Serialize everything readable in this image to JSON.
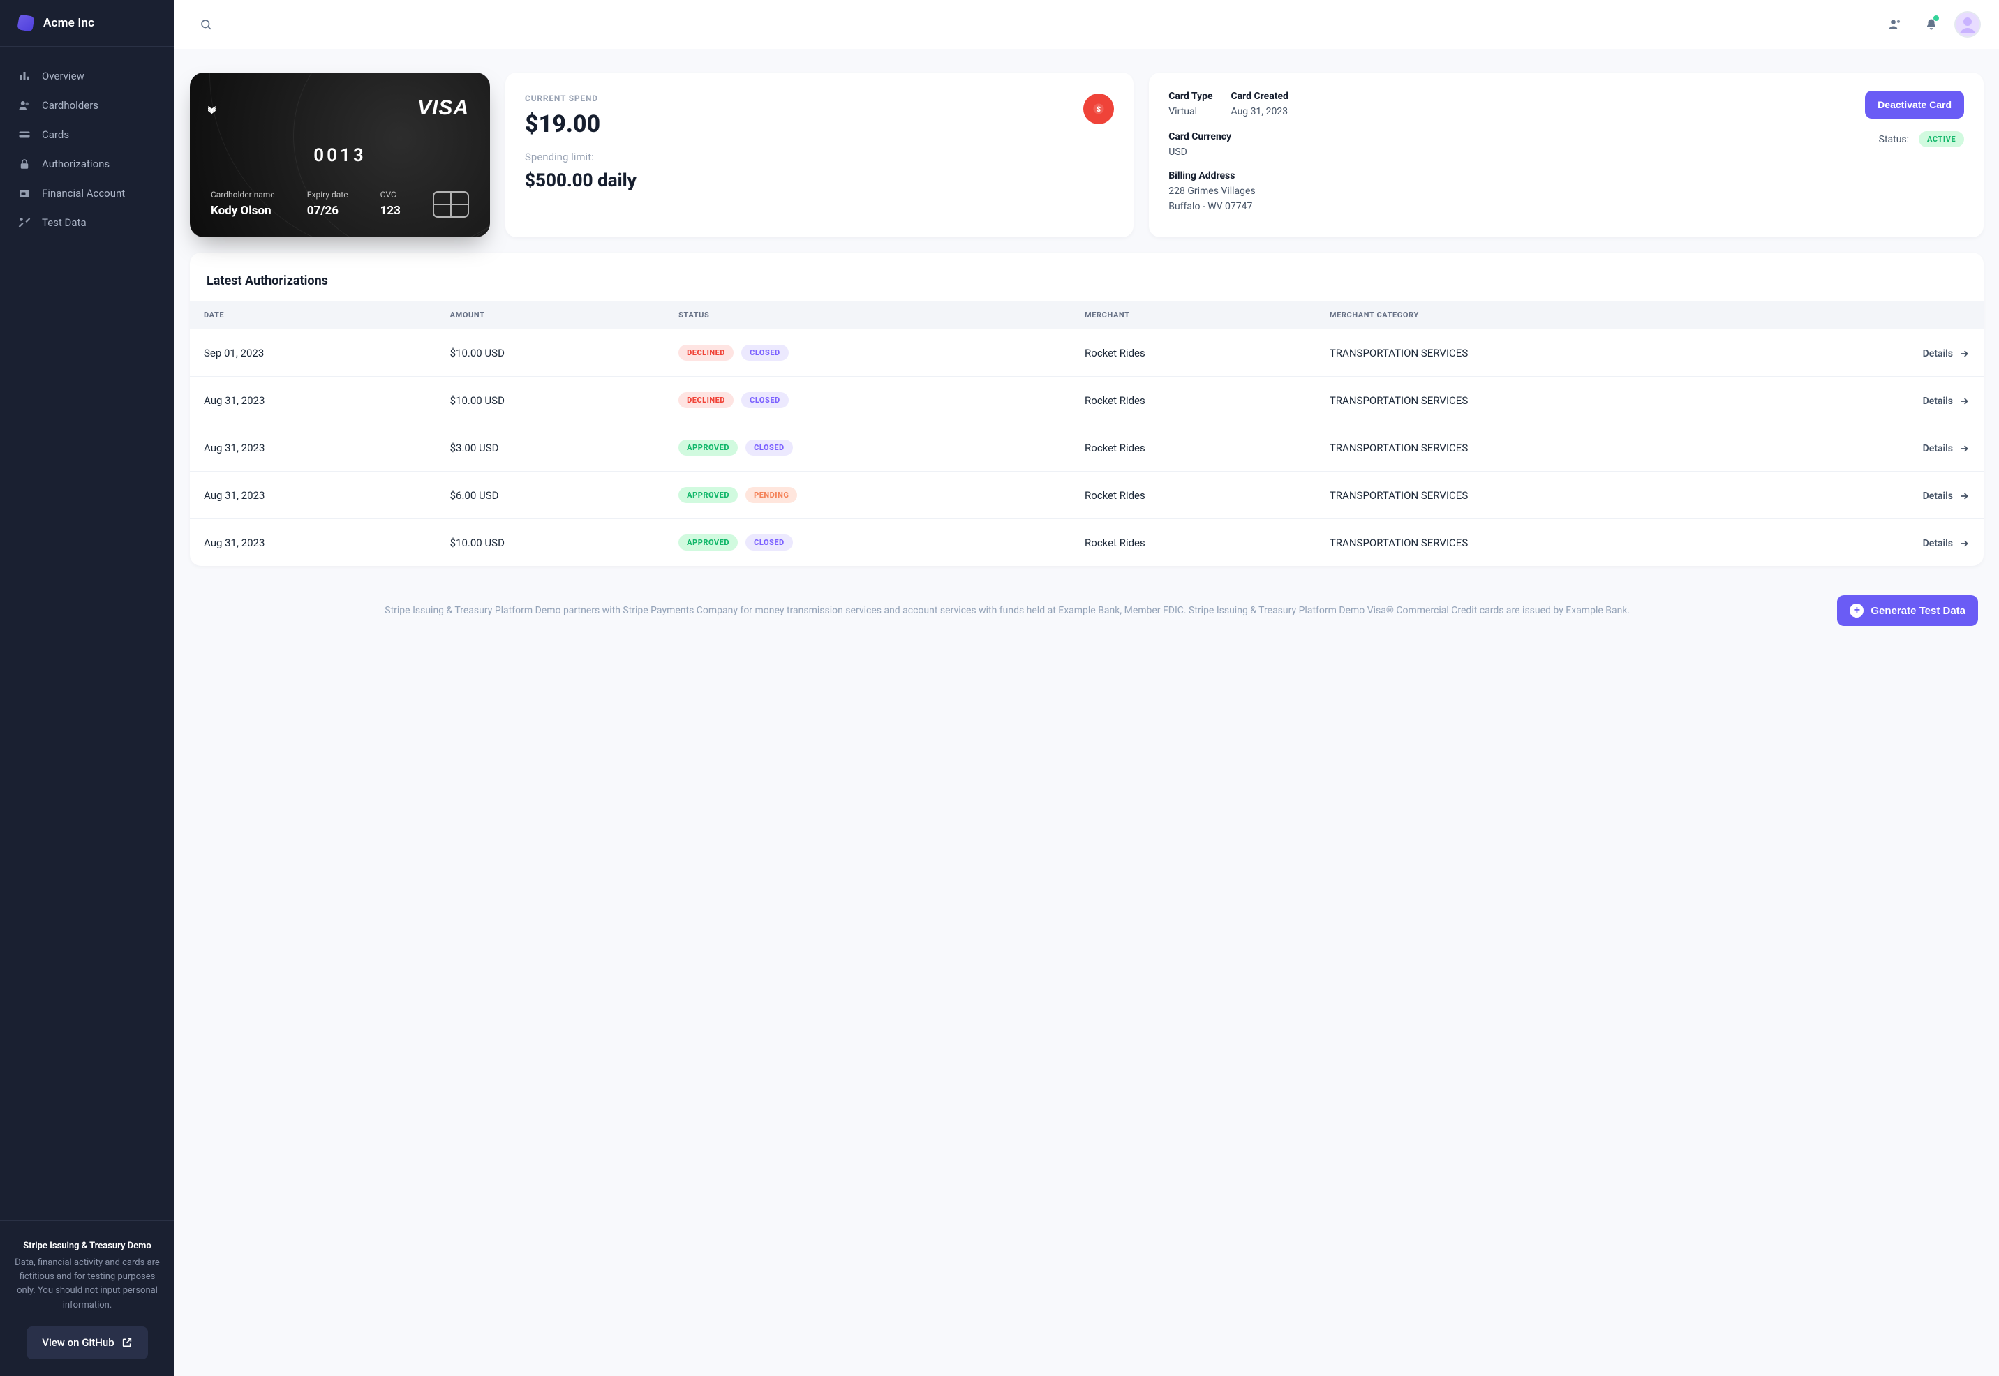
{
  "brand": {
    "name": "Acme Inc"
  },
  "nav": [
    {
      "label": "Overview"
    },
    {
      "label": "Cardholders"
    },
    {
      "label": "Cards"
    },
    {
      "label": "Authorizations"
    },
    {
      "label": "Financial Account"
    },
    {
      "label": "Test Data"
    }
  ],
  "sidebar_footer": {
    "title": "Stripe Issuing & Treasury Demo",
    "body": "Data, financial activity and cards are fictitious and for testing purposes only. You should not input personal information.",
    "github": "View on GitHub"
  },
  "card": {
    "network": "VISA",
    "last4": "0013",
    "holder_label": "Cardholder name",
    "holder": "Kody Olson",
    "expiry_label": "Expiry date",
    "expiry": "07/26",
    "cvc_label": "CVC",
    "cvc": "123"
  },
  "spend": {
    "label": "CURRENT SPEND",
    "amount": "$19.00",
    "limit_label": "Spending limit:",
    "limit": "$500.00 daily"
  },
  "meta": {
    "type_k": "Card Type",
    "type_v": "Virtual",
    "created_k": "Card Created",
    "created_v": "Aug 31, 2023",
    "currency_k": "Card Currency",
    "currency_v": "USD",
    "status_k": "Status:",
    "status_v": "ACTIVE",
    "address_k": "Billing Address",
    "address_l1": "228 Grimes Villages",
    "address_l2": "Buffalo - WV 07747",
    "deactivate": "Deactivate Card"
  },
  "auth": {
    "title": "Latest Authorizations",
    "headers": {
      "date": "DATE",
      "amount": "AMOUNT",
      "status": "STATUS",
      "merchant": "MERCHANT",
      "category": "MERCHANT CATEGORY"
    },
    "rows": [
      {
        "date": "Sep 01, 2023",
        "amount": "$10.00 USD",
        "status": "DECLINED",
        "sclass": "red",
        "state": "CLOSED",
        "stclass": "purple",
        "merchant": "Rocket Rides",
        "category": "TRANSPORTATION SERVICES"
      },
      {
        "date": "Aug 31, 2023",
        "amount": "$10.00 USD",
        "status": "DECLINED",
        "sclass": "red",
        "state": "CLOSED",
        "stclass": "purple",
        "merchant": "Rocket Rides",
        "category": "TRANSPORTATION SERVICES"
      },
      {
        "date": "Aug 31, 2023",
        "amount": "$3.00 USD",
        "status": "APPROVED",
        "sclass": "green",
        "state": "CLOSED",
        "stclass": "purple",
        "merchant": "Rocket Rides",
        "category": "TRANSPORTATION SERVICES"
      },
      {
        "date": "Aug 31, 2023",
        "amount": "$6.00 USD",
        "status": "APPROVED",
        "sclass": "green",
        "state": "PENDING",
        "stclass": "peach",
        "merchant": "Rocket Rides",
        "category": "TRANSPORTATION SERVICES"
      },
      {
        "date": "Aug 31, 2023",
        "amount": "$10.00 USD",
        "status": "APPROVED",
        "sclass": "green",
        "state": "CLOSED",
        "stclass": "purple",
        "merchant": "Rocket Rides",
        "category": "TRANSPORTATION SERVICES"
      }
    ],
    "details": "Details"
  },
  "footer": {
    "note": "Stripe Issuing & Treasury Platform Demo partners with Stripe Payments Company for money transmission services and account services with funds held at Example Bank, Member FDIC. Stripe Issuing & Treasury Platform Demo Visa® Commercial Credit cards are issued by Example Bank.",
    "generate": "Generate Test Data"
  }
}
